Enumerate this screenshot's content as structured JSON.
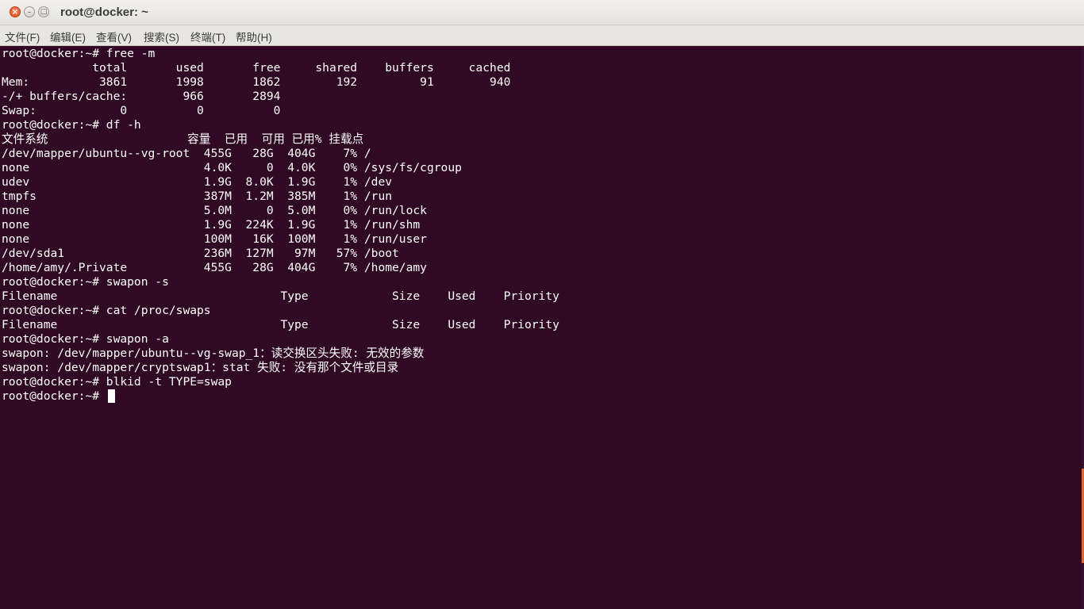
{
  "window": {
    "title": "root@docker: ~",
    "close_glyph": "×",
    "minimize_glyph": "–",
    "maximize_glyph": "□"
  },
  "menu": {
    "items": [
      "文件(F)",
      "编辑(E)",
      "查看(V)",
      "搜索(S)",
      "终端(T)",
      "帮助(H)"
    ]
  },
  "terminal": {
    "lines": [
      "root@docker:~# free -m",
      "             total       used       free     shared    buffers     cached",
      "Mem:          3861       1998       1862        192         91        940",
      "-/+ buffers/cache:        966       2894",
      "Swap:            0          0          0",
      "root@docker:~# df -h",
      "文件系统                    容量  已用  可用 已用% 挂载点",
      "/dev/mapper/ubuntu--vg-root  455G   28G  404G    7% /",
      "none                         4.0K     0  4.0K    0% /sys/fs/cgroup",
      "udev                         1.9G  8.0K  1.9G    1% /dev",
      "tmpfs                        387M  1.2M  385M    1% /run",
      "none                         5.0M     0  5.0M    0% /run/lock",
      "none                         1.9G  224K  1.9G    1% /run/shm",
      "none                         100M   16K  100M    1% /run/user",
      "/dev/sda1                    236M  127M   97M   57% /boot",
      "/home/amy/.Private           455G   28G  404G    7% /home/amy",
      "root@docker:~# swapon -s",
      "Filename                                Type            Size    Used    Priority",
      "root@docker:~# cat /proc/swaps",
      "Filename                                Type            Size    Used    Priority",
      "root@docker:~# swapon -a",
      "swapon: /dev/mapper/ubuntu--vg-swap_1：读交换区头失败: 无效的参数",
      "swapon: /dev/mapper/cryptswap1：stat 失败: 没有那个文件或目录",
      "root@docker:~# blkid -t TYPE=swap",
      "root@docker:~# "
    ]
  }
}
